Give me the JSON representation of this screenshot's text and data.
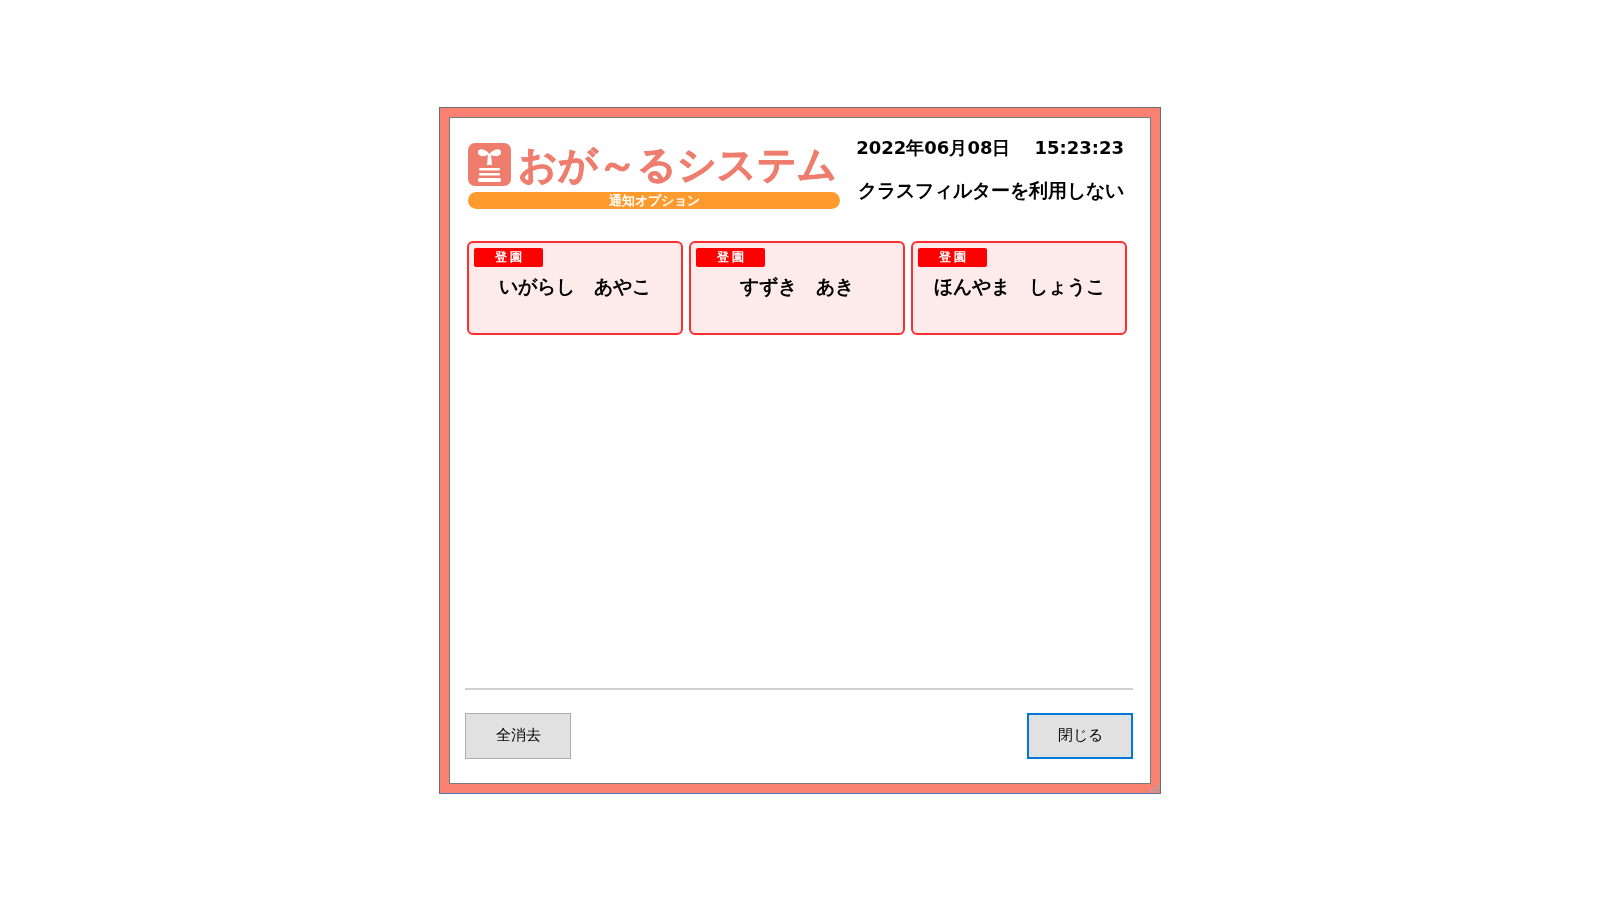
{
  "app": {
    "title": "おが～るシステム",
    "subtitle": "通知オプション"
  },
  "date": "2022年06月08日",
  "time": "15:23:23",
  "class_filter": "クラスフィルターを利用しない",
  "notifications": [
    {
      "status": "登園",
      "name": "いがらし　あやこ"
    },
    {
      "status": "登園",
      "name": "すずき　あき"
    },
    {
      "status": "登園",
      "name": "ほんやま　しょうこ"
    }
  ],
  "buttons": [
    {
      "label": "全消去",
      "focused": false
    },
    {
      "label": "閉じる",
      "focused": true
    }
  ]
}
